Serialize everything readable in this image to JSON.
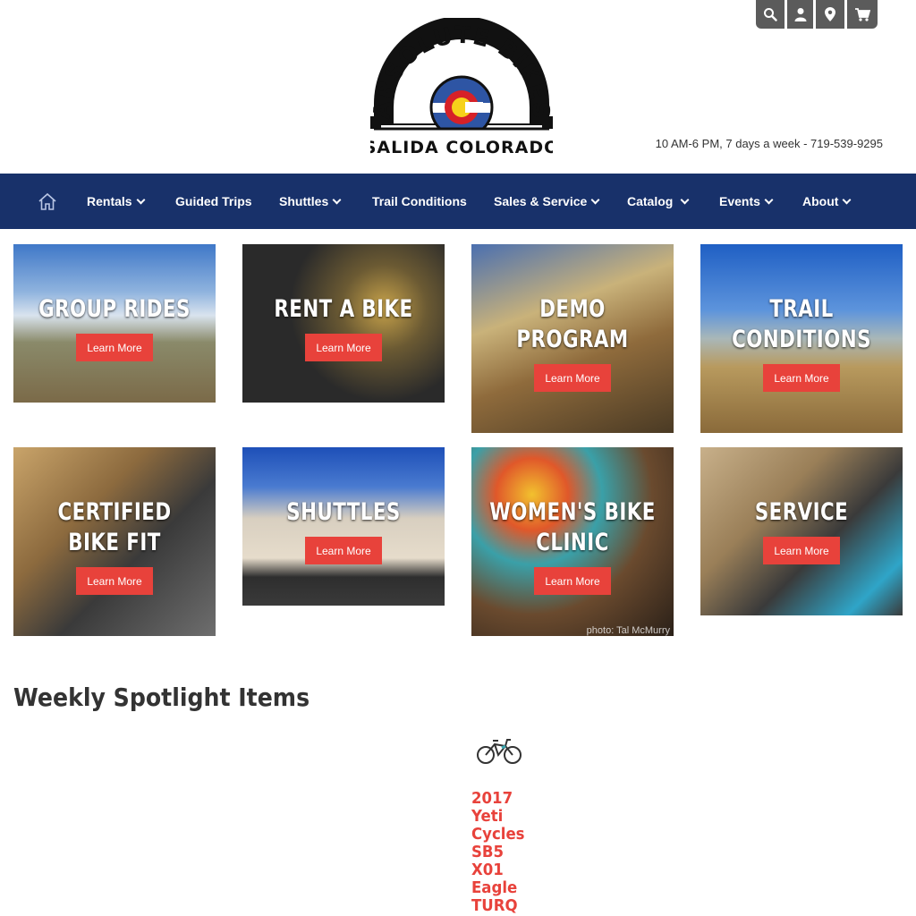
{
  "utility": {
    "icons": [
      "search-icon",
      "account-icon",
      "location-icon",
      "cart-icon"
    ]
  },
  "header": {
    "logo_text_top": "ABSOLUTE BIKES",
    "logo_text_bottom": "SALIDA COLORADO",
    "hours": "10 AM-6 PM, 7 days a week - 719-539-9295"
  },
  "nav": {
    "items": [
      {
        "label": "Rentals",
        "dropdown": true
      },
      {
        "label": "Guided Trips",
        "dropdown": false
      },
      {
        "label": "Shuttles",
        "dropdown": true
      },
      {
        "label": "Trail Conditions",
        "dropdown": false
      },
      {
        "label": "Sales & Service",
        "dropdown": true
      },
      {
        "label": "Catalog",
        "dropdown": true
      },
      {
        "label": "Events",
        "dropdown": true
      },
      {
        "label": "About",
        "dropdown": true
      }
    ]
  },
  "tiles": [
    {
      "title_lines": [
        "GROUP RIDES"
      ],
      "button": "Learn More"
    },
    {
      "title_lines": [
        "RENT A BIKE"
      ],
      "button": "Learn More"
    },
    {
      "title_lines": [
        "DEMO",
        "PROGRAM"
      ],
      "button": "Learn More"
    },
    {
      "title_lines": [
        "TRAIL",
        "CONDITIONS"
      ],
      "button": "Learn More"
    },
    {
      "title_lines": [
        "CERTIFIED",
        "BIKE FIT"
      ],
      "button": "Learn More"
    },
    {
      "title_lines": [
        "SHUTTLES"
      ],
      "button": "Learn More"
    },
    {
      "title_lines": [
        "WOMEN'S BIKE",
        "CLINIC"
      ],
      "button": "Learn More",
      "credit": "photo: Tal McMurry"
    },
    {
      "title_lines": [
        "SERVICE"
      ],
      "button": "Learn More"
    }
  ],
  "spotlight": {
    "heading": "Weekly Spotlight Items",
    "item_lines": [
      "2017",
      "Yeti",
      "Cycles",
      "SB5",
      "X01",
      "Eagle",
      "TURQ"
    ]
  },
  "colors": {
    "nav_bg": "#18316a",
    "accent_red": "#e8423b",
    "utility_bg": "#5b5b5b"
  }
}
